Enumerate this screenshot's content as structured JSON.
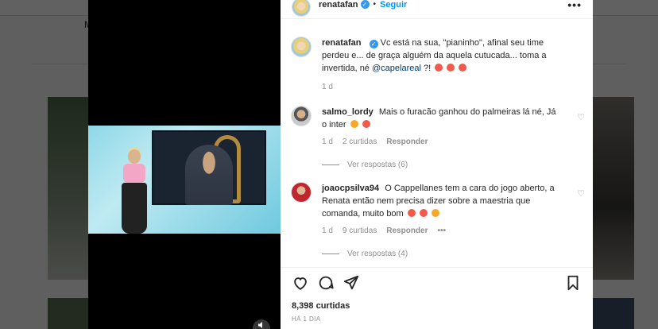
{
  "background": {
    "nav_text": "M"
  },
  "post": {
    "author": "renatafan",
    "follow_label": "Seguir",
    "separator": "•",
    "more_label": "•••",
    "caption": {
      "author": "renatafan",
      "text_1": "Vc está na sua, \"pianinho\", afinal seu time perdeu e... de graça alguém da aquela cutucada... toma a invertida, né",
      "mention": "@capelareal",
      "text_2": "?!",
      "time": "1 d"
    },
    "comments": [
      {
        "author": "salmo_lordy",
        "text": "Mais o furacão ganhou do palmeiras lá né, Já o inter",
        "time": "1 d",
        "likes": "2 curtidas",
        "reply_label": "Responder",
        "view_replies": "Ver respostas (6)"
      },
      {
        "author": "joaocpsilva94",
        "text": "O Cappellanes tem a cara do jogo aberto, a Renata então nem precisa dizer sobre a maestria que comanda, muito bom",
        "time": "1 d",
        "likes": "9 curtidas",
        "reply_label": "Responder",
        "more_label": "•••",
        "view_replies": "Ver respostas (4)"
      }
    ],
    "like_count": "8,398 curtidas",
    "posted_ago": "HÁ 1 DIA"
  },
  "colors": {
    "accent_blue": "#0095f6",
    "verified_blue": "#3897f0",
    "muted_text": "#8e8e8e",
    "overlay": "rgba(0,0,0,0.62)"
  },
  "icons": [
    "verified-icon",
    "more-options-icon",
    "heart-icon",
    "comment-icon",
    "share-icon",
    "bookmark-icon",
    "sound-icon"
  ]
}
